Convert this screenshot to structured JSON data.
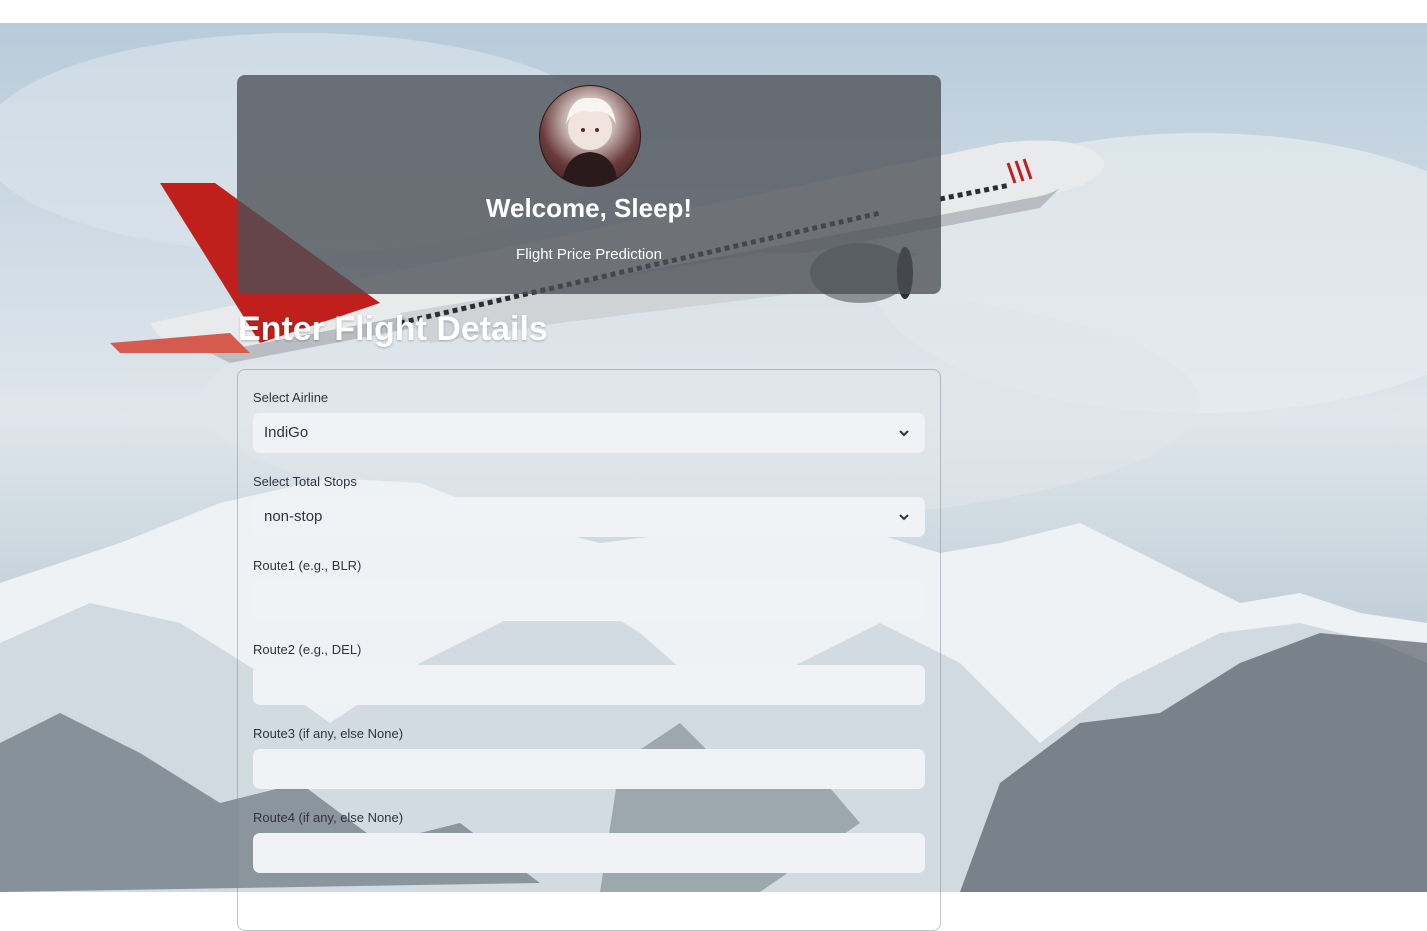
{
  "header": {
    "welcome_title": "Welcome, Sleep!",
    "subtitle": "Flight Price Prediction"
  },
  "form": {
    "section_title": "Enter Flight Details",
    "airline": {
      "label": "Select Airline",
      "value": "IndiGo"
    },
    "total_stops": {
      "label": "Select Total Stops",
      "value": "non-stop"
    },
    "route1": {
      "label": "Route1 (e.g., BLR)",
      "value": ""
    },
    "route2": {
      "label": "Route2 (e.g., DEL)",
      "value": ""
    },
    "route3": {
      "label": "Route3 (if any, else None)",
      "value": ""
    },
    "route4": {
      "label": "Route4 (if any, else None)",
      "value": ""
    }
  },
  "colors": {
    "card_background": "#4b5056",
    "input_background": "#f0f2f6",
    "label_text": "#31333f"
  },
  "icons": {
    "select_arrow": "chevron-down-icon",
    "avatar": "user-avatar"
  }
}
